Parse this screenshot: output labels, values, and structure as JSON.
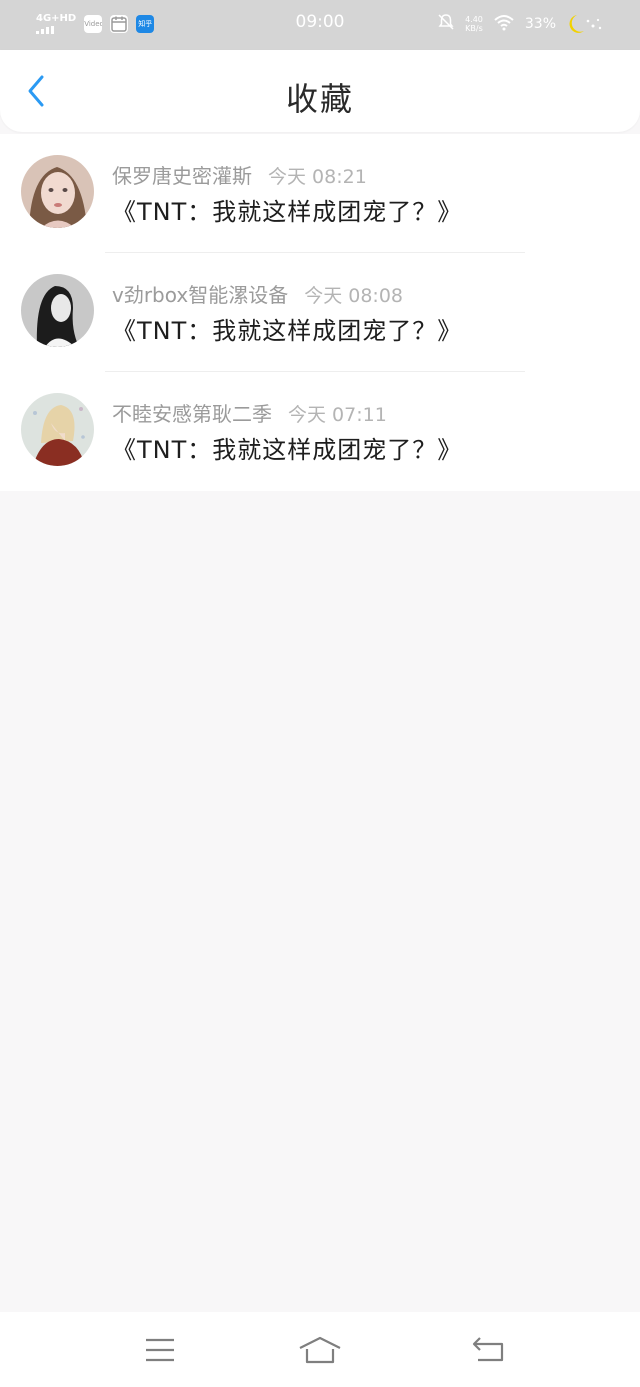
{
  "status_bar": {
    "network": "4G+HD",
    "app_icon_1": "Video",
    "app_icon_3": "知乎",
    "time": "09:00",
    "speed_value": "4.40",
    "speed_unit": "KB/s",
    "battery": "33%",
    "icons": [
      "signal-icon",
      "video-app-icon",
      "calendar-app-icon",
      "zhihu-app-icon",
      "mute-icon",
      "wifi-icon",
      "moon-icon"
    ]
  },
  "header": {
    "title": "收藏",
    "back_icon": "chevron-left-icon",
    "accent_color": "#2b9af3"
  },
  "favorites": [
    {
      "author": "保罗唐史密灌斯",
      "time": "今天 08:21",
      "title": "《TNT：我就这样成团宠了？》",
      "avatar": "avatar-girl-portrait"
    },
    {
      "author": "v劲rbox智能漯设备",
      "time": "今天 08:08",
      "title": "《TNT：我就这样成团宠了？》",
      "avatar": "avatar-bw-woman"
    },
    {
      "author": "不睦安感第耿二季",
      "time": "今天 07:11",
      "title": "《TNT：我就这样成团宠了？》",
      "avatar": "avatar-blonde-woman"
    }
  ],
  "nav_bar": {
    "icons": [
      "menu-icon",
      "home-icon",
      "back-icon"
    ]
  }
}
